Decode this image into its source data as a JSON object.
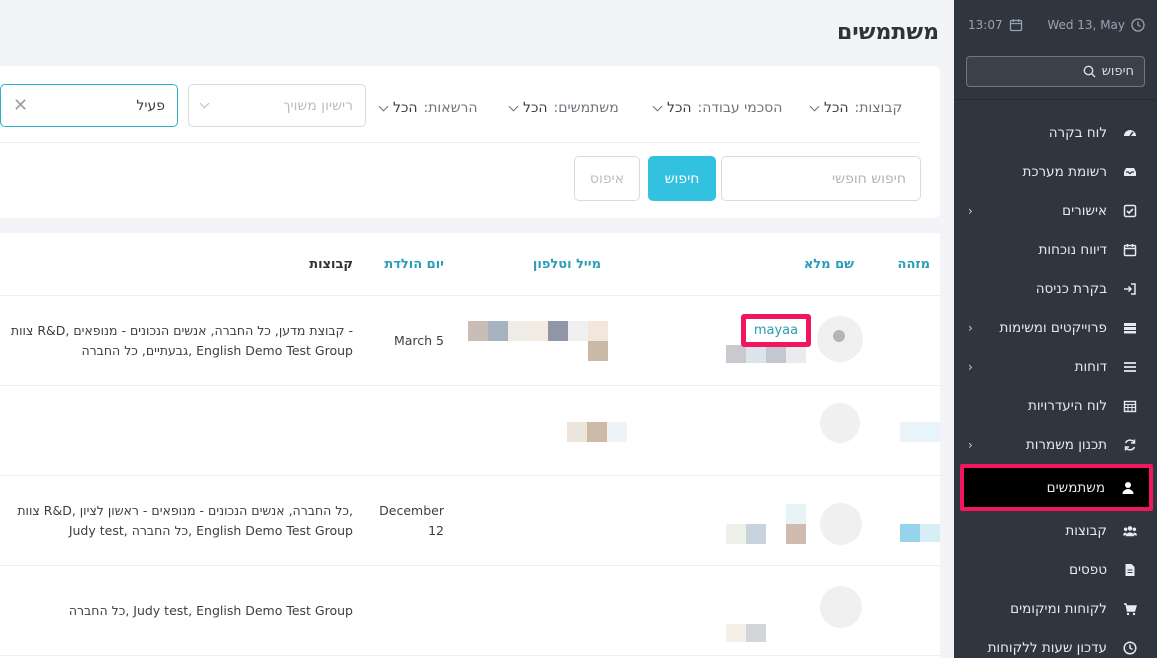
{
  "topbar": {
    "time": "13:07",
    "date": "Wed 13, May"
  },
  "sidebar": {
    "search_label": "חיפוש",
    "items": [
      {
        "label": "לוח בקרה",
        "icon": "dashboard-icon",
        "chevron": false
      },
      {
        "label": "רשומת מערכת",
        "icon": "inbox-icon",
        "chevron": false
      },
      {
        "label": "אישורים",
        "icon": "check-square-icon",
        "chevron": true
      },
      {
        "label": "דיווח נוכחות",
        "icon": "calendar-icon",
        "chevron": false
      },
      {
        "label": "בקרת כניסה",
        "icon": "sign-in-icon",
        "chevron": false
      },
      {
        "label": "פרוייקטים ומשימות",
        "icon": "tasks-icon",
        "chevron": true
      },
      {
        "label": "דוחות",
        "icon": "list-icon",
        "chevron": true
      },
      {
        "label": "לוח היעדרויות",
        "icon": "calendar-grid-icon",
        "chevron": false
      },
      {
        "label": "תכנון משמרות",
        "icon": "refresh-icon",
        "chevron": true
      },
      {
        "label": "משתמשים",
        "icon": "user-icon",
        "chevron": false,
        "active": true
      },
      {
        "label": "קבוצות",
        "icon": "users-icon",
        "chevron": false
      },
      {
        "label": "טפסים",
        "icon": "file-icon",
        "chevron": false
      },
      {
        "label": "לקוחות ומיקומים",
        "icon": "cart-icon",
        "chevron": false
      },
      {
        "label": "עדכון שעות ללקוחות",
        "icon": "clock-icon",
        "chevron": false
      }
    ]
  },
  "page": {
    "title": "משתמשים"
  },
  "filters": {
    "groups_label": "קבוצות:",
    "groups_value": "הכל",
    "agreements_label": "הסכמי עבודה:",
    "agreements_value": "הכל",
    "users_label": "משתמשים:",
    "users_value": "הכל",
    "permissions_label": "הרשאות:",
    "permissions_value": "הכל",
    "license_placeholder": "רישיון משויך",
    "status_value": "פעיל",
    "free_search_placeholder": "חיפוש חופשי",
    "search_button": "חיפוש",
    "reset_button": "איפוס"
  },
  "table": {
    "headers": {
      "id": "מזהה",
      "full_name": "שם מלא",
      "email_phone": "מייל וטלפון",
      "birthday": "יום הולדת",
      "groups": "קבוצות"
    },
    "rows": [
      {
        "full_name": "mayaa",
        "birthday": "March 5",
        "groups_line1": "צוות R&D, קבוצת מדען, כל החברה, אנשים הנכונים - מנופאים -",
        "groups_line2": "גבעתיים, כל החברה, English Demo Test Group"
      },
      {
        "full_name": "",
        "birthday": "",
        "groups_line1": "",
        "groups_line2": ""
      },
      {
        "full_name": "",
        "birthday_line1": "December",
        "birthday_line2": "12",
        "groups_line1": "צוות R&D, כל החברה, אנשים הנכונים - מנופאים - ראשון לציון,",
        "groups_line2": "Judy test, כל החברה, English Demo Test Group"
      },
      {
        "full_name": "",
        "birthday": "",
        "groups_line1": "כל החברה, Judy test, English Demo Test Group",
        "groups_line2": ""
      }
    ]
  },
  "colors": {
    "accent": "#33c1e0",
    "highlight": "#f0175e",
    "sidebar": "#2f3640"
  }
}
